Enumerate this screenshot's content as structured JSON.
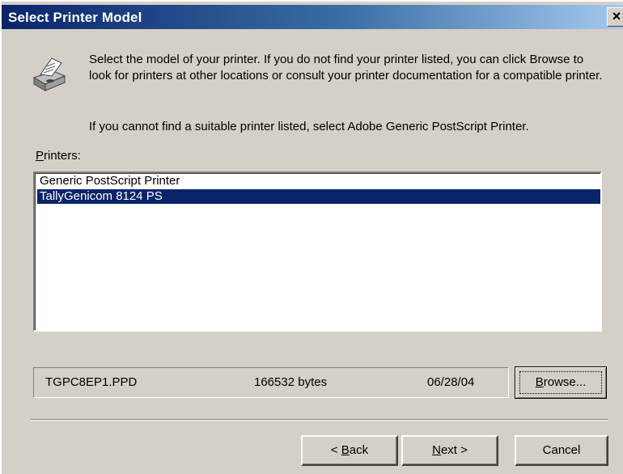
{
  "window": {
    "title": "Select Printer Model",
    "close_label": "×"
  },
  "instructions": {
    "line1": "Select the model of your printer. If you do not find your printer listed, you can click Browse to look for printers at other locations or consult your printer documentation for a compatible printer.",
    "line2": "If you cannot find a suitable printer listed, select Adobe Generic PostScript Printer."
  },
  "printers": {
    "label_mnemonic": "P",
    "label_rest": "rinters:",
    "items": [
      {
        "label": "Generic PostScript Printer",
        "selected": false
      },
      {
        "label": "TallyGenicom 8124 PS",
        "selected": true
      }
    ]
  },
  "file_info": {
    "filename": "TGPC8EP1.PPD",
    "size": "166532 bytes",
    "date": "06/28/04"
  },
  "buttons": {
    "browse_mnemonic": "B",
    "browse_rest": "rowse...",
    "back_prefix": "< ",
    "back_mnemonic": "B",
    "back_rest": "ack",
    "next_mnemonic": "N",
    "next_rest": "ext >",
    "cancel": "Cancel"
  },
  "icons": {
    "printer": "printer-icon",
    "close": "close-icon"
  }
}
